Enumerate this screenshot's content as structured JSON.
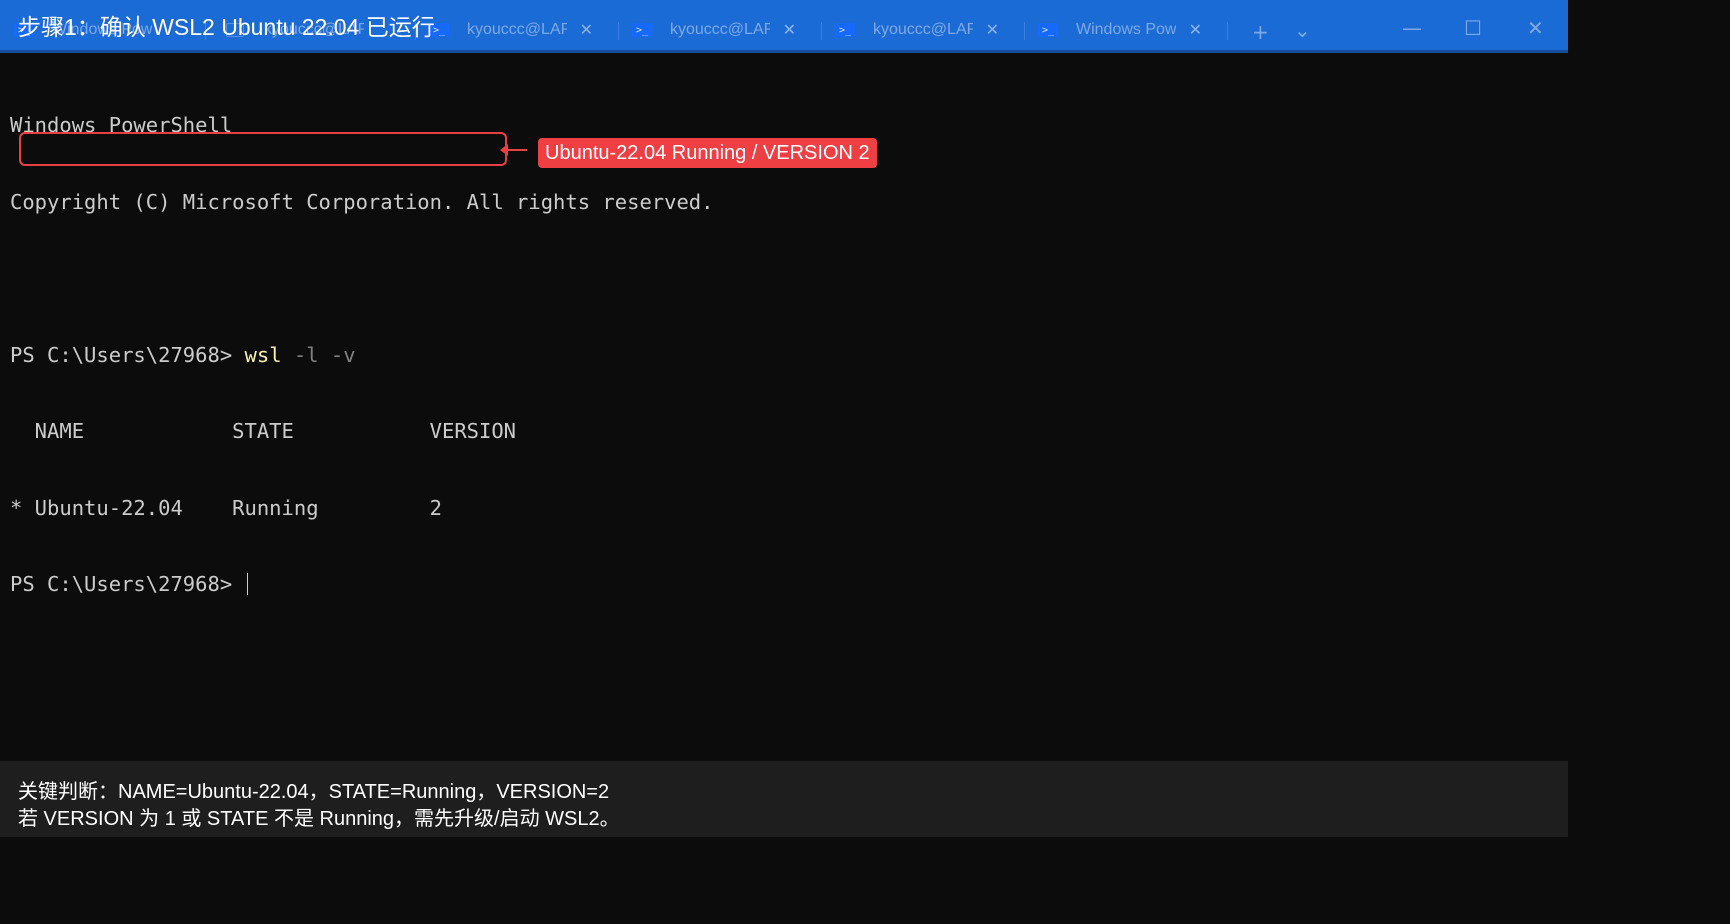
{
  "title": "步骤1：确认 WSL2 Ubuntu 22.04 已运行",
  "tabs": [
    {
      "label": "Windows Pow",
      "icon": "powershell-icon"
    },
    {
      "label": "kyouccc@LAP",
      "icon": "linux-terminal-icon"
    },
    {
      "label": "kyouccc@LAP",
      "icon": "powershell-icon"
    },
    {
      "label": "kyouccc@LAP",
      "icon": "powershell-icon"
    },
    {
      "label": "kyouccc@LAP",
      "icon": "powershell-icon"
    },
    {
      "label": "Windows Pow",
      "icon": "powershell-icon"
    }
  ],
  "tab_controls": {
    "new_tab": "+",
    "dropdown": "⌄"
  },
  "window_controls": {
    "minimize": "—",
    "maximize": "☐",
    "close": "✕"
  },
  "terminal": {
    "banner": [
      "Windows PowerShell",
      "Copyright (C) Microsoft Corporation. All rights reserved."
    ],
    "prompt": "PS C:\\Users\\27968>",
    "command": "wsl",
    "args": "-l -v",
    "output_header": "  NAME            STATE           VERSION",
    "output_row": "* Ubuntu-22.04    Running         2"
  },
  "annotation": "Ubuntu-22.04 Running / VERSION 2",
  "footer": {
    "line1": "关键判断：NAME=Ubuntu-22.04，STATE=Running，VERSION=2",
    "line2": "若 VERSION 为 1 或 STATE 不是 Running，需先升级/启动 WSL2。"
  },
  "colors": {
    "tabbar": "#1b6bd6",
    "terminal_bg": "#0c0c0c",
    "highlight": "#e8403f",
    "command": "#f9f1a5"
  }
}
